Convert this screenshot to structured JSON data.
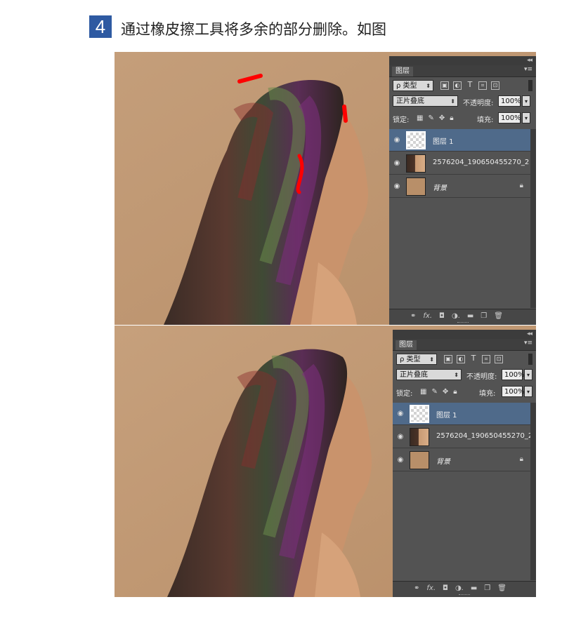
{
  "step": {
    "number": "4",
    "title": "通过橡皮擦工具将多余的部分删除。如图"
  },
  "screenshots": [
    {
      "panel": {
        "tab": "图层",
        "filter_kind": "ρ 类型",
        "blend_mode": "正片叠底",
        "opacity_label": "不透明度:",
        "opacity_value": "100%",
        "lock_label": "锁定:",
        "fill_label": "填充:",
        "fill_value": "100%",
        "layers": [
          {
            "name": "图层 1",
            "selected": true,
            "thumb": "transparent"
          },
          {
            "name": "2576204_190650455270_2",
            "selected": false,
            "thumb": "portrait"
          },
          {
            "name": "背景",
            "selected": false,
            "thumb": "fill",
            "locked": true
          }
        ]
      },
      "annotations": "red-strokes"
    },
    {
      "panel": {
        "tab": "图层",
        "filter_kind": "ρ 类型",
        "blend_mode": "正片叠底",
        "opacity_label": "不透明度:",
        "opacity_value": "100%",
        "lock_label": "锁定:",
        "fill_label": "填充:",
        "fill_value": "100%",
        "layers": [
          {
            "name": "图层 1",
            "selected": true,
            "thumb": "transparent"
          },
          {
            "name": "2576204_190650455270_2",
            "selected": false,
            "thumb": "portrait"
          },
          {
            "name": "背景",
            "selected": false,
            "thumb": "fill",
            "locked": true
          }
        ]
      }
    }
  ],
  "icons": {
    "collapse": "double-chevron-icon",
    "panel_menu": "panel-menu-icon",
    "eye": "eye-icon",
    "lock": "lock-icon",
    "filter_icons": [
      "image-filter-icon",
      "adjustment-filter-icon",
      "type-filter-icon",
      "shape-filter-icon",
      "smart-object-filter-icon"
    ],
    "lock_icons": [
      "lock-transparent-icon",
      "lock-paint-icon",
      "lock-move-icon",
      "lock-all-icon"
    ],
    "bottom_icons": [
      "link-icon",
      "fx-icon",
      "mask-icon",
      "adjustment-icon",
      "folder-icon",
      "new-layer-icon",
      "trash-icon"
    ]
  },
  "colors": {
    "badge": "#2e5aa2",
    "backdrop": "#c09a76",
    "panel": "#535353",
    "selected_layer": "#4f6a8a",
    "annotation": "#ff0000"
  }
}
